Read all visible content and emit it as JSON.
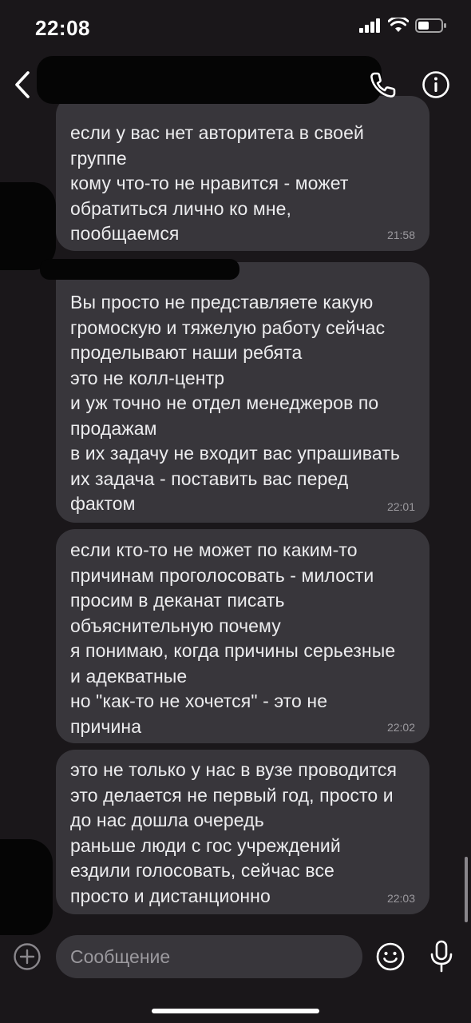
{
  "status_bar": {
    "time": "22:08"
  },
  "header": {
    "icons": [
      "chevron-left-icon",
      "phone-icon",
      "info-icon"
    ]
  },
  "messages": [
    {
      "text": "если у вас нет авторитета в своей\nгруппе\nкому что-то не нравится - может\nобратиться лично ко мне,\nпообщаемся",
      "time": "21:58"
    },
    {
      "text": "Вы просто не представляете какую\nгромоскую и тяжелую работу сейчас\nпроделывают наши ребята\nэто не колл-центр\nи уж точно не отдел менеджеров по\nпродажам\nв их задачу не входит вас упрашивать\nих задача - поставить вас перед\nфактом",
      "time": "22:01"
    },
    {
      "text": "если кто-то не может по каким-то\nпричинам проголосовать - милости\nпросим в деканат писать\nобъяснительную почему\nя понимаю, когда причины серьезные\nи адекватные\nно \"как-то не хочется\" - это не\nпричина",
      "time": "22:02"
    },
    {
      "text": "это не только у нас в вузе проводится\nэто делается не первый год, просто и\nдо нас дошла очередь\nраньше люди с гос учреждений\nездили голосовать, сейчас все\nпросто и дистанционно",
      "time": "22:03"
    }
  ],
  "composer": {
    "placeholder": "Сообщение",
    "icons": [
      "add-icon",
      "emoji-icon",
      "microphone-icon"
    ]
  },
  "colors": {
    "background": "#1a171a",
    "bubble": "#38363b",
    "text": "#ececee",
    "muted": "#9b999e"
  }
}
